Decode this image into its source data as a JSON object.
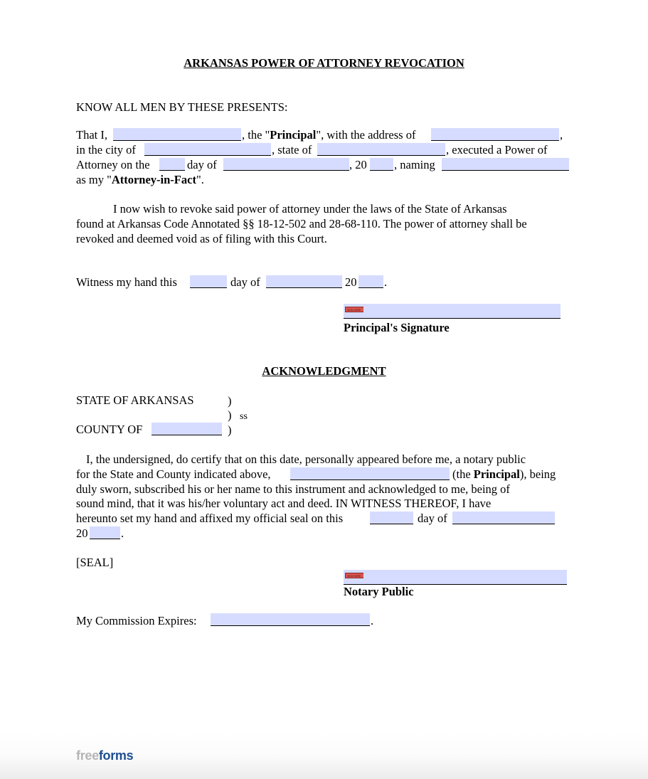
{
  "document": {
    "title": "ARKANSAS POWER OF ATTORNEY REVOCATION",
    "preamble": "KNOW ALL MEN BY THESE PRESENTS:",
    "para1": {
      "l1a": "That I,",
      "l1b": ", the \"",
      "l1_bold": "Principal",
      "l1c": "\", with the address of",
      "l1d": ",",
      "l2a": "in the city of",
      "l2b": ", state of",
      "l2c": ", executed a Power of",
      "l3a": "Attorney on the",
      "l3b": "day of",
      "l3c": ", 20",
      "l3d": ", naming",
      "l4a": "as my \"",
      "l4_bold": "Attorney-in-Fact",
      "l4b": "\"."
    },
    "para2": {
      "l1": "I now wish to revoke said power of attorney under the laws of the State of Arkansas",
      "l2": "found at Arkansas Code Annotated §§ 18-12-502 and 28-68-110.  The power of attorney shall be",
      "l3": "revoked and deemed void as of filing with this Court."
    },
    "witness": {
      "a": "Witness my hand this",
      "b": "day of",
      "c": "20",
      "d": "."
    },
    "principal_signature_label": "Principal's Signature",
    "sign_tag_text": "SIGN HERE",
    "acknowledgment": {
      "title": "ACKNOWLEDGMENT",
      "state_label": "STATE OF ARKANSAS",
      "paren": ")",
      "ss": "ss",
      "county_label": "COUNTY OF",
      "p1": "I, the undersigned, do certify that on this date, personally appeared before me, a notary public",
      "p2a": "for the State and County indicated above,",
      "p2b": "(the ",
      "p2_bold": "Principal",
      "p2c": "), being",
      "p3": "duly sworn, subscribed his or her name to this instrument and acknowledged to me, being of",
      "p4": "sound mind, that it was his/her voluntary act and deed.  IN WITNESS THEREOF, I have",
      "p5a": "hereunto set my hand and affixed my official seal on this",
      "p5b": "day of",
      "p6a": "20",
      "p6b": ".",
      "seal": "[SEAL]",
      "notary_label": "Notary Public",
      "commission_label": "My Commission Expires:",
      "commission_end": "."
    },
    "fields": {
      "principal_name": "",
      "principal_address": "",
      "city": "",
      "state": "",
      "poa_day": "",
      "poa_month": "",
      "poa_year": "",
      "attorney_in_fact": "",
      "witness_day": "",
      "witness_month": "",
      "witness_year": "",
      "county": "",
      "ack_principal_name": "",
      "ack_day": "",
      "ack_month": "",
      "ack_year": "",
      "commission_expires": ""
    }
  },
  "footer": {
    "logo_part1": "free",
    "logo_part2": "forms"
  },
  "colors": {
    "field_fill": "#d6dcff",
    "logo_gray": "#b5b5b5",
    "logo_blue": "#1d4f91",
    "sign_tag": "#d9534f"
  }
}
